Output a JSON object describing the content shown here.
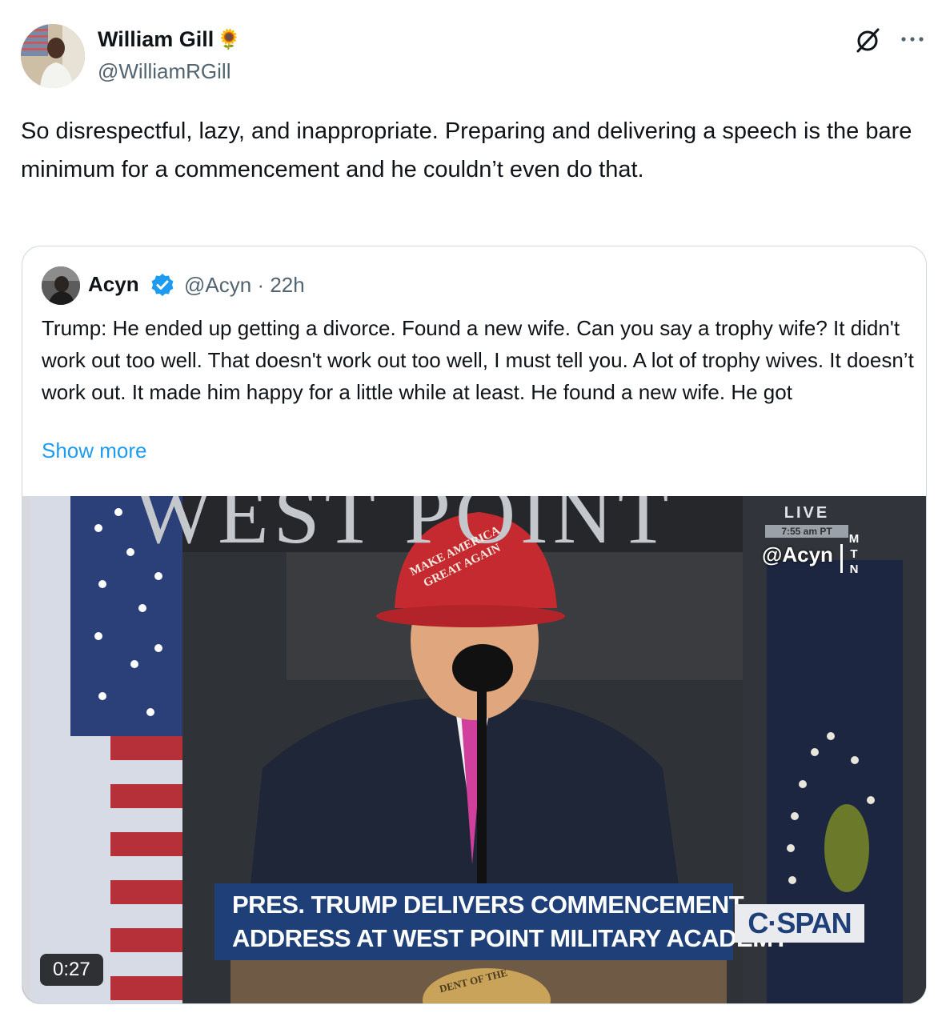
{
  "author": {
    "name": "William Gill",
    "emoji": "🌻",
    "handle": "@WilliamRGill"
  },
  "tweet": {
    "text": "So disrespectful, lazy, and inappropriate. Preparing and delivering a speech is the bare minimum for a commencement and he couldn’t even do that."
  },
  "quoted": {
    "name": "Acyn",
    "handle": "@Acyn",
    "separator": "·",
    "time": "22h",
    "text": "Trump: He ended up getting a divorce. Found a new wife. Can you say a trophy wife? It didn't work out too well. That doesn't work out too well, I must tell you. A lot of trophy wives. It doesn’t work out. It made him happy for a little while at least. He found a new wife. He got",
    "show_more": "Show more",
    "video": {
      "duration": "0:27",
      "backdrop_text": "WEST POINT",
      "live_label": "LIVE",
      "live_time": "7:55 am PT",
      "watermark_handle": "@Acyn",
      "watermark_letters": [
        "M",
        "T",
        "N"
      ],
      "hat_text_1": "MAKE AMERICA",
      "hat_text_2": "GREAT AGAIN",
      "chyron_line1": "PRES. TRUMP DELIVERS COMMENCEMENT",
      "chyron_line2": "ADDRESS AT WEST POINT MILITARY ACADEMY",
      "network": "C·SPAN",
      "seal_text": "DENT OF THE"
    }
  },
  "colors": {
    "link": "#1d9bf0",
    "verified": "#1d9bf0",
    "secondary_text": "#536471",
    "border": "#cfd9de",
    "chyron": "#1e3f77"
  }
}
